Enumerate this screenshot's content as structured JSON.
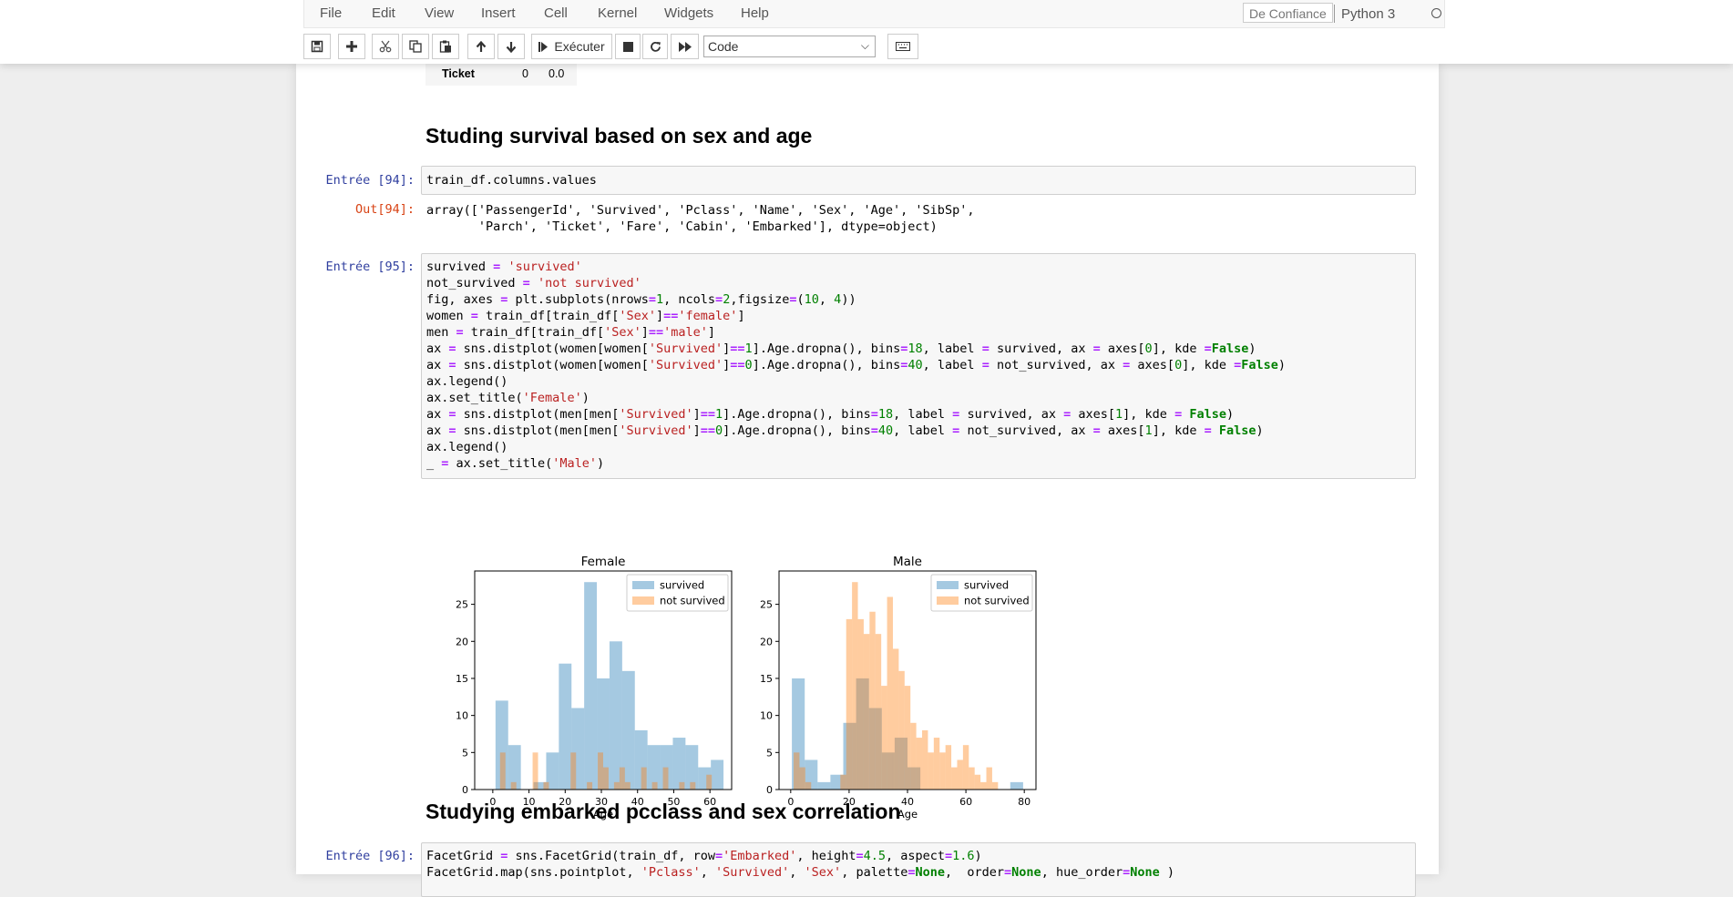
{
  "menu": {
    "items": [
      "File",
      "Edit",
      "View",
      "Insert",
      "Cell",
      "Kernel",
      "Widgets",
      "Help"
    ],
    "trusted": "De Confiance",
    "kernel": "Python 3"
  },
  "toolbar": {
    "run_label": "Exécuter",
    "cell_type": "Code"
  },
  "cells": {
    "table_tail": {
      "label": "Ticket",
      "col1": "0",
      "col2": "0.0"
    },
    "heading1": "Studing survival based on sex and age",
    "cell94": {
      "prompt_in": "Entrée [94]:",
      "code": "train_df.columns.values",
      "prompt_out": "Out[94]:",
      "output_line1": "array(['PassengerId', 'Survived', 'Pclass', 'Name', 'Sex', 'Age', 'SibSp',",
      "output_line2": "       'Parch', 'Ticket', 'Fare', 'Cabin', 'Embarked'], dtype=object)"
    },
    "cell95": {
      "prompt_in": "Entrée [95]:"
    },
    "heading2": "Studying embarked pcclass and sex correlation",
    "cell96": {
      "prompt_in": "Entrée [96]:"
    }
  },
  "chart_data": [
    {
      "type": "bar",
      "title": "Female",
      "xlabel": "Age",
      "ylabel": "",
      "xlim": [
        -5,
        66
      ],
      "ylim": [
        0,
        29.5
      ],
      "xticks": [
        0,
        10,
        20,
        30,
        40,
        50,
        60
      ],
      "yticks": [
        0,
        5,
        10,
        15,
        20,
        25
      ],
      "legend": {
        "position": "top-right",
        "entries": [
          "survived",
          "not survived"
        ]
      },
      "series": [
        {
          "name": "survived",
          "color": "#1f77b4",
          "bin_start": 0.75,
          "bin_width": 3.5,
          "values": [
            12,
            6,
            0,
            1,
            5,
            17,
            11,
            28,
            15,
            20,
            16,
            8,
            6,
            6,
            7,
            6,
            3,
            4
          ]
        },
        {
          "name": "not survived",
          "color": "#ff7f0e",
          "bin_start": 2,
          "bin_width": 1.5,
          "values": [
            5,
            0,
            1,
            0,
            0,
            0,
            5,
            0,
            1,
            0,
            0,
            0,
            0,
            5,
            0,
            0,
            1,
            0,
            5,
            3,
            0,
            1,
            3,
            1,
            0,
            0,
            3,
            0,
            1,
            0,
            3,
            0,
            0,
            1,
            0,
            1,
            0,
            0,
            2,
            0
          ]
        }
      ]
    },
    {
      "type": "bar",
      "title": "Male",
      "xlabel": "Age",
      "ylabel": "",
      "xlim": [
        -4,
        84
      ],
      "ylim": [
        0,
        29.5
      ],
      "xticks": [
        0,
        20,
        40,
        60,
        80
      ],
      "yticks": [
        0,
        5,
        10,
        15,
        20,
        25
      ],
      "legend": {
        "position": "top-right",
        "entries": [
          "survived",
          "not survived"
        ]
      },
      "series": [
        {
          "name": "survived",
          "color": "#1f77b4",
          "bin_start": 0.4,
          "bin_width": 4.4,
          "values": [
            15,
            4,
            1,
            2,
            9,
            15,
            11,
            5,
            7,
            3,
            0,
            0,
            0,
            0,
            0,
            0,
            0,
            1
          ]
        },
        {
          "name": "not survived",
          "color": "#ff7f0e",
          "bin_start": 1,
          "bin_width": 2,
          "values": [
            5,
            3,
            1,
            0,
            0,
            0,
            0,
            0,
            2,
            23,
            28,
            23,
            21,
            24,
            21,
            14,
            26,
            19,
            16,
            14,
            9,
            7,
            8,
            5,
            7,
            5,
            6,
            3,
            4,
            6,
            3,
            2,
            1,
            3,
            1,
            0,
            0,
            0,
            0,
            0
          ]
        }
      ]
    }
  ]
}
